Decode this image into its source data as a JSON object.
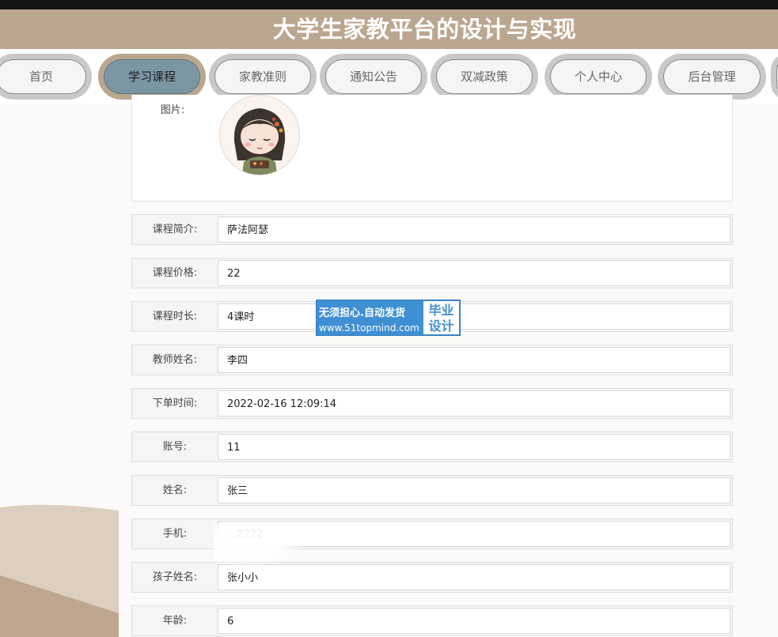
{
  "header": {
    "title": "大学生家教平台的设计与实现"
  },
  "nav": {
    "items": [
      {
        "label": "首页"
      },
      {
        "label": "学习课程"
      },
      {
        "label": "家教准则"
      },
      {
        "label": "通知公告"
      },
      {
        "label": "双减政策"
      },
      {
        "label": "个人中心"
      },
      {
        "label": "后台管理"
      }
    ],
    "active": "学习课程"
  },
  "detail": {
    "image_label": "图片:",
    "fields": [
      {
        "label": "课程简介:",
        "value": "萨法阿瑟"
      },
      {
        "label": "课程价格:",
        "value": "22"
      },
      {
        "label": "课程时长:",
        "value": "4课时"
      },
      {
        "label": "教师姓名:",
        "value": "李四"
      },
      {
        "label": "下单时间:",
        "value": "2022-02-16 12:09:14"
      },
      {
        "label": "账号:",
        "value": "11"
      },
      {
        "label": "姓名:",
        "value": "张三"
      },
      {
        "label": "手机:",
        "value": "...2222"
      },
      {
        "label": "孩子姓名:",
        "value": "张小小"
      },
      {
        "label": "年龄:",
        "value": "6"
      }
    ]
  },
  "watermark": {
    "main": "无须担心.自动发货",
    "url": "www.51topmind.com",
    "side_line1": "毕业",
    "side_line2": "设计"
  },
  "colors": {
    "banner": "#bba68f",
    "active_tab": "#7b96a3",
    "pill_ring": "#c9c9c9",
    "watermark": "#3f8fd3"
  }
}
